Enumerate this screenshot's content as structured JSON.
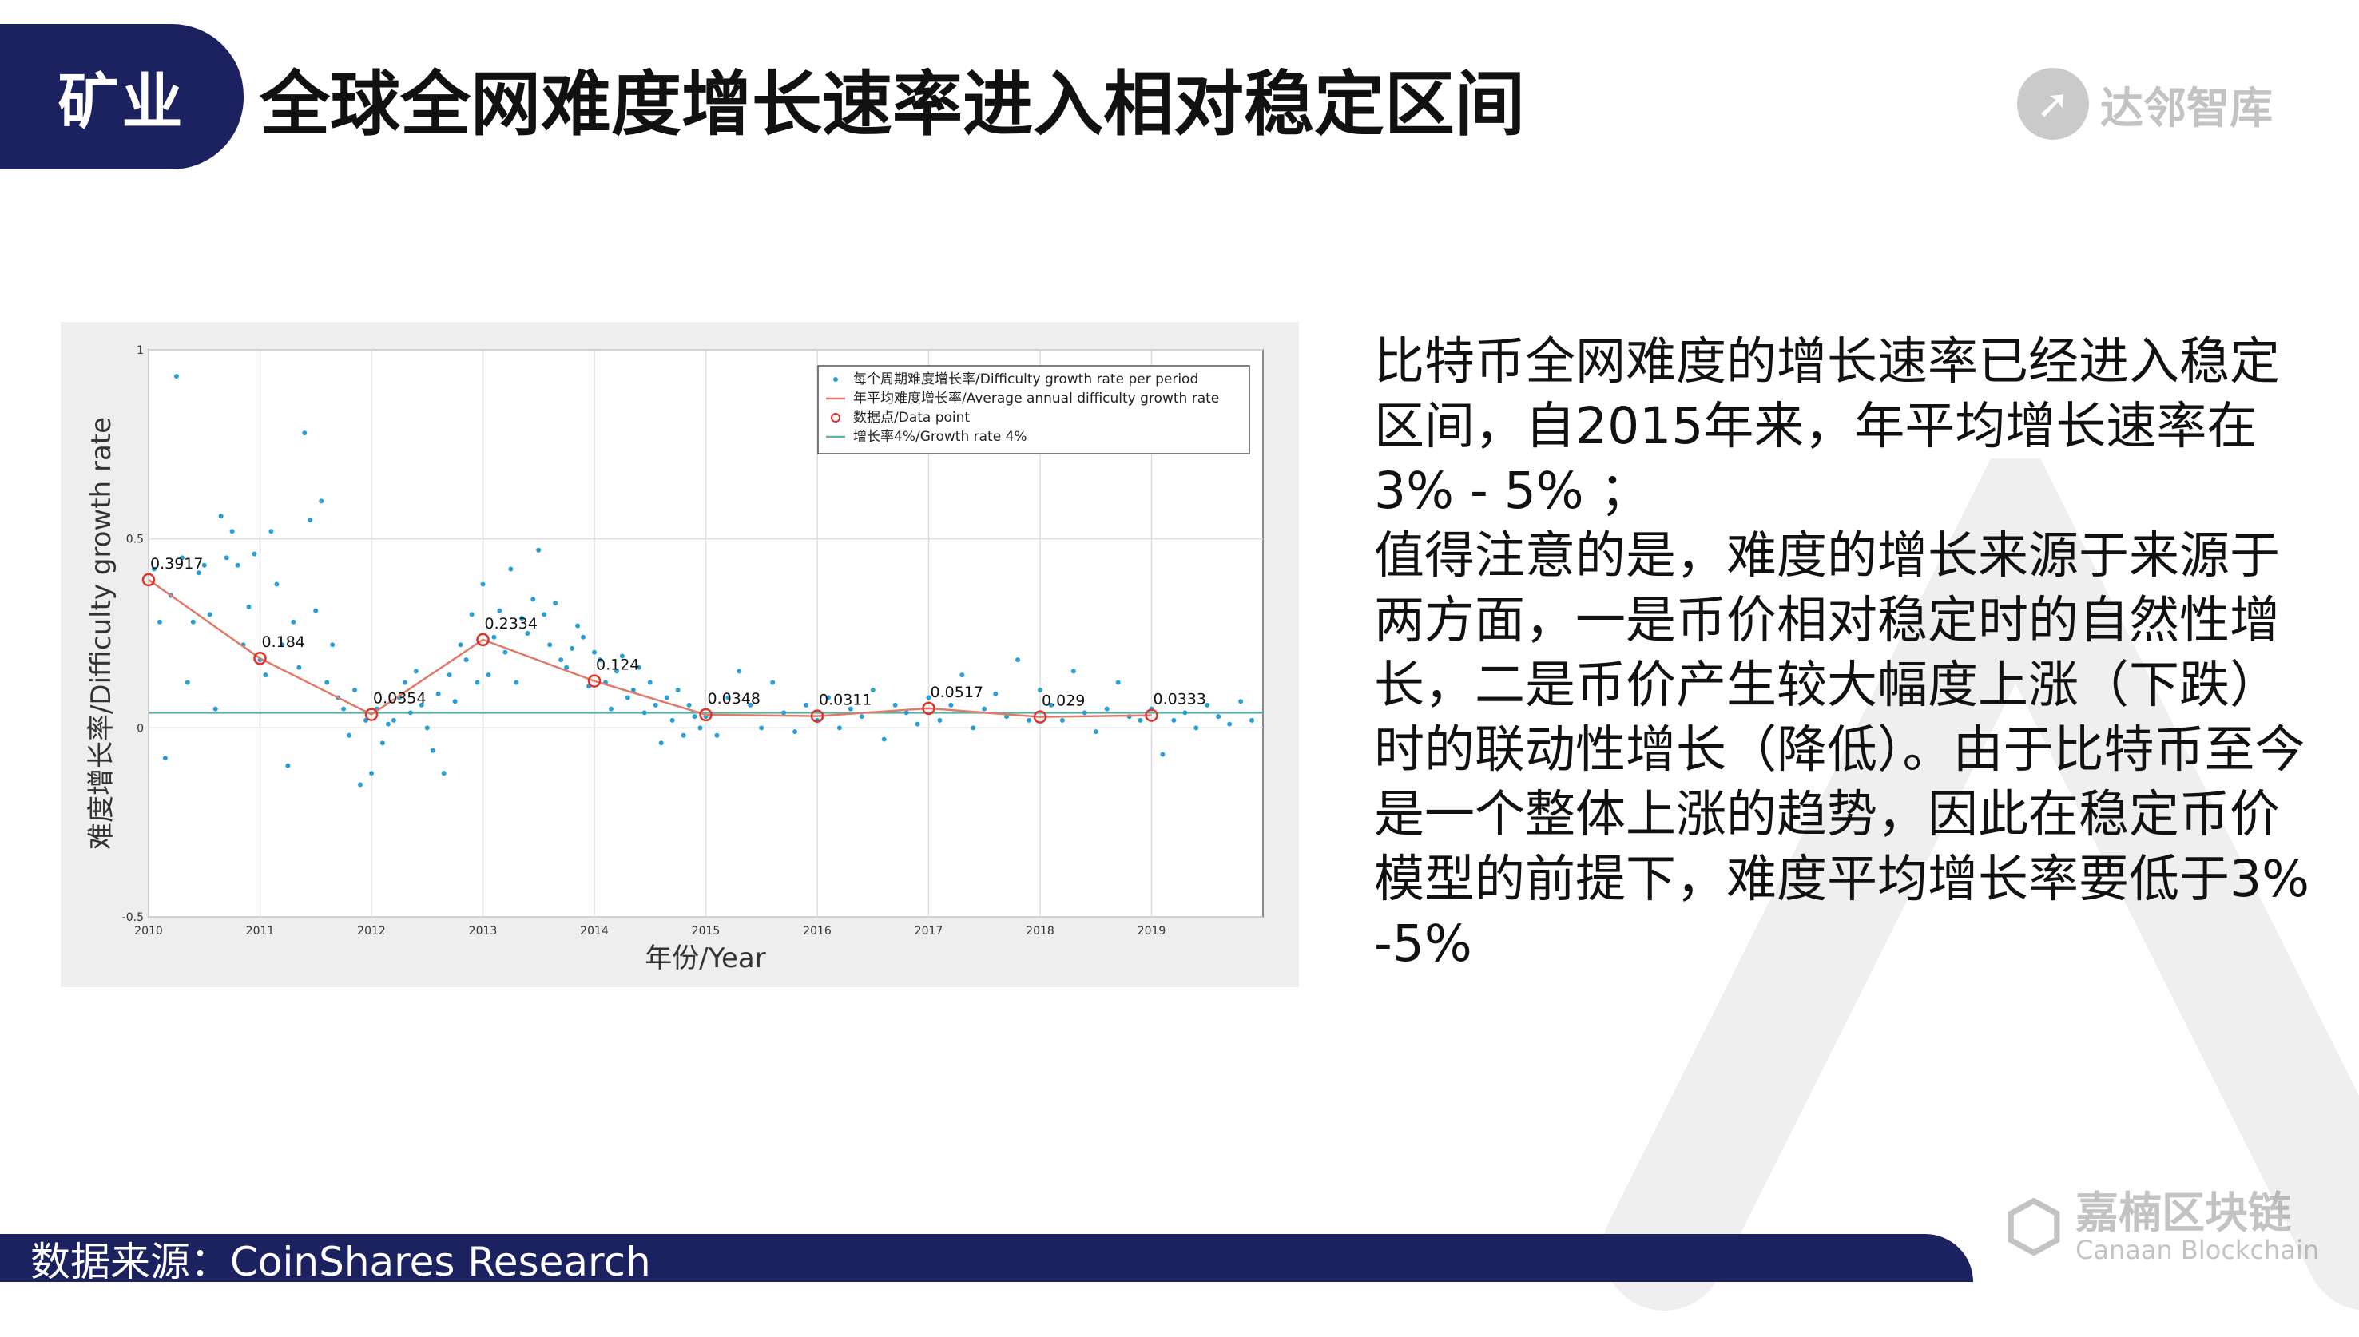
{
  "header": {
    "section_tag": "矿业",
    "title": "全球全网难度增长速率进入相对稳定区间",
    "logo_text": "达邻智库"
  },
  "body": {
    "paragraph1": "比特币全网难度的增长速率已经进入稳定区间，自2015年来，年平均增长速率在3% - 5% ；",
    "paragraph2": "值得注意的是，难度的增长来源于来源于两方面，一是币价相对稳定时的自然性增长，二是币价产生较大幅度上涨（下跌）时的联动性增长（降低）。由于比特币至今是一个整体上涨的趋势，因此在稳定币价模型的前提下，难度平均增长率要低于3% -5%"
  },
  "footer": {
    "source": "数据来源：CoinShares Research",
    "brand_cn": "嘉楠区块链",
    "brand_en": "Canaan Blockchain"
  },
  "colors": {
    "navy": "#1c2160",
    "scatter": "#2a9fd6",
    "line": "#e07b6a",
    "baseline": "#5fb0a9"
  },
  "chart_data": {
    "type": "scatter",
    "xlabel": "年份/Year",
    "ylabel": "难度增长率/Difficulty growth rate",
    "xlim": [
      2010,
      2020
    ],
    "ylim": [
      -0.5,
      1
    ],
    "xticks": [
      "2010",
      "2011",
      "2012",
      "2013",
      "2014",
      "2015",
      "2016",
      "2017",
      "2018",
      "2019"
    ],
    "yticks": [
      {
        "value": 1,
        "label": "1"
      },
      {
        "value": 0.5,
        "label": "0.5"
      },
      {
        "value": 0,
        "label": "0"
      },
      {
        "value": -0.5,
        "label": "-0.5"
      }
    ],
    "grid": true,
    "legend_position": "top-right",
    "legend": [
      "每个周期难度增长率/Difficulty growth rate per period",
      "年平均难度增长率/Average annual difficulty growth rate",
      "数据点/Data point",
      "增长率4%/Growth rate 4%"
    ],
    "annual_average": {
      "x": [
        2010,
        2011,
        2012,
        2013,
        2014,
        2015,
        2016,
        2017,
        2018,
        2019
      ],
      "y": [
        0.3917,
        0.184,
        0.0354,
        0.2334,
        0.124,
        0.0348,
        0.0311,
        0.0517,
        0.029,
        0.0333
      ],
      "labels": [
        "0.3917",
        "0.184",
        "0.0354",
        "0.2334",
        "0.124",
        "0.0348",
        "0.0311",
        "0.0517",
        "0.029",
        "0.0333"
      ]
    },
    "reference_line": {
      "y": 0.04
    },
    "per_period": {
      "x": [
        2010.05,
        2010.1,
        2010.15,
        2010.2,
        2010.25,
        2010.3,
        2010.35,
        2010.4,
        2010.45,
        2010.5,
        2010.55,
        2010.6,
        2010.65,
        2010.7,
        2010.75,
        2010.8,
        2010.85,
        2010.9,
        2010.95,
        2011.0,
        2011.05,
        2011.1,
        2011.15,
        2011.2,
        2011.25,
        2011.3,
        2011.35,
        2011.4,
        2011.45,
        2011.5,
        2011.55,
        2011.6,
        2011.65,
        2011.7,
        2011.75,
        2011.8,
        2011.85,
        2011.9,
        2011.95,
        2012.0,
        2012.05,
        2012.1,
        2012.15,
        2012.2,
        2012.25,
        2012.3,
        2012.35,
        2012.4,
        2012.45,
        2012.5,
        2012.55,
        2012.6,
        2012.65,
        2012.7,
        2012.75,
        2012.8,
        2012.85,
        2012.9,
        2012.95,
        2013.0,
        2013.05,
        2013.1,
        2013.15,
        2013.2,
        2013.25,
        2013.3,
        2013.35,
        2013.4,
        2013.45,
        2013.5,
        2013.55,
        2013.6,
        2013.65,
        2013.7,
        2013.75,
        2013.8,
        2013.85,
        2013.9,
        2013.95,
        2014.0,
        2014.05,
        2014.1,
        2014.15,
        2014.2,
        2014.25,
        2014.3,
        2014.35,
        2014.4,
        2014.45,
        2014.5,
        2014.55,
        2014.6,
        2014.65,
        2014.7,
        2014.75,
        2014.8,
        2014.85,
        2014.9,
        2014.95,
        2015.0,
        2015.1,
        2015.2,
        2015.3,
        2015.4,
        2015.5,
        2015.6,
        2015.7,
        2015.8,
        2015.9,
        2016.0,
        2016.1,
        2016.2,
        2016.3,
        2016.4,
        2016.5,
        2016.6,
        2016.7,
        2016.8,
        2016.9,
        2017.0,
        2017.1,
        2017.2,
        2017.3,
        2017.4,
        2017.5,
        2017.6,
        2017.7,
        2017.8,
        2017.9,
        2018.0,
        2018.1,
        2018.2,
        2018.3,
        2018.4,
        2018.5,
        2018.6,
        2018.7,
        2018.8,
        2018.9,
        2019.0,
        2019.1,
        2019.2,
        2019.3,
        2019.4,
        2019.5,
        2019.6,
        2019.7,
        2019.8,
        2019.9
      ],
      "y": [
        0.42,
        0.28,
        -0.08,
        0.35,
        0.93,
        0.45,
        0.12,
        0.28,
        0.41,
        0.43,
        0.3,
        0.05,
        0.56,
        0.45,
        0.52,
        0.43,
        0.22,
        0.32,
        0.46,
        0.18,
        0.14,
        0.52,
        0.38,
        0.22,
        -0.1,
        0.28,
        0.16,
        0.78,
        0.55,
        0.31,
        0.6,
        0.12,
        0.22,
        0.08,
        0.05,
        -0.02,
        0.1,
        -0.15,
        0.02,
        -0.12,
        0.05,
        -0.04,
        0.01,
        0.02,
        0.08,
        0.12,
        0.04,
        0.15,
        0.06,
        0.0,
        -0.06,
        0.09,
        -0.12,
        0.14,
        0.07,
        0.22,
        0.18,
        0.3,
        0.12,
        0.38,
        0.14,
        0.24,
        0.31,
        0.2,
        0.42,
        0.12,
        0.29,
        0.25,
        0.34,
        0.47,
        0.3,
        0.22,
        0.33,
        0.18,
        0.16,
        0.21,
        0.27,
        0.24,
        0.11,
        0.2,
        0.18,
        0.12,
        0.05,
        0.15,
        0.19,
        0.08,
        0.1,
        0.16,
        0.04,
        0.12,
        0.06,
        -0.04,
        0.08,
        0.02,
        0.1,
        -0.02,
        0.06,
        0.03,
        0.0,
        0.03,
        -0.02,
        0.08,
        0.15,
        0.06,
        0.0,
        0.12,
        0.04,
        -0.01,
        0.06,
        0.02,
        0.08,
        0.0,
        0.05,
        0.03,
        0.1,
        -0.03,
        0.06,
        0.04,
        0.01,
        0.08,
        0.02,
        0.06,
        0.14,
        0.0,
        0.05,
        0.09,
        0.03,
        0.18,
        0.02,
        0.1,
        0.06,
        0.02,
        0.15,
        0.04,
        -0.01,
        0.05,
        0.12,
        0.03,
        0.02,
        0.05,
        -0.07,
        0.02,
        0.04,
        0.0,
        0.06,
        0.03,
        0.01,
        0.07,
        0.02
      ]
    }
  }
}
